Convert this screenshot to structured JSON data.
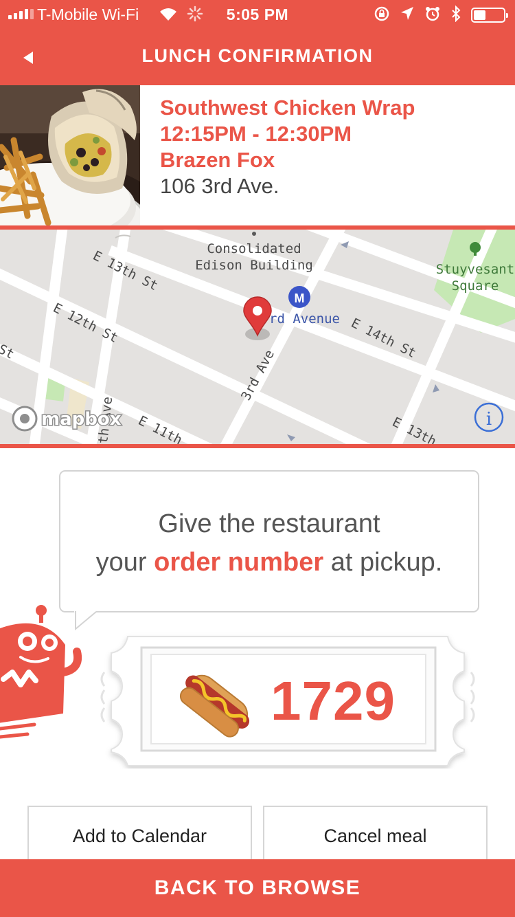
{
  "status_bar": {
    "carrier": "T-Mobile Wi-Fi",
    "time": "5:05 PM",
    "battery_level": 0.42,
    "icons": [
      "signal-icon",
      "wifi-icon",
      "activity-spinner-icon",
      "rotation-lock-icon",
      "location-icon",
      "alarm-icon",
      "bluetooth-icon",
      "battery-icon"
    ]
  },
  "nav": {
    "title": "LUNCH CONFIRMATION",
    "back_icon": "back-arrow-icon"
  },
  "meal": {
    "name": "Southwest Chicken Wrap",
    "time_window": "12:15PM - 12:30PM",
    "restaurant": "Brazen Fox",
    "address": "106 3rd Ave."
  },
  "map": {
    "labels": {
      "landmark": [
        "Consolidated",
        "Edison Building"
      ],
      "park": [
        "Stuyvesant",
        "Square"
      ],
      "station": "rd Avenue",
      "e13": "E 13th St",
      "e12": "E 12th St",
      "e14": "E 14th St",
      "third_ave": "3rd Ave",
      "e11": "E 11th",
      "e13_right": "E 13th",
      "fourth_ave": "th Ave",
      "st_left": "St",
      "attribution": "mapbox"
    },
    "icons": [
      "map-pin-icon",
      "subway-icon",
      "park-tree-icon",
      "mapbox-logo-icon",
      "info-icon"
    ]
  },
  "instructions": {
    "line1": "Give the restaurant",
    "line2_pre": "your ",
    "line2_emphasis": "order number",
    "line2_post": " at pickup."
  },
  "order": {
    "emoji": "🌭",
    "number": "1729"
  },
  "actions": {
    "add_to_calendar": "Add to Calendar",
    "cancel_meal": "Cancel meal",
    "back_to_browse": "BACK TO BROWSE"
  },
  "colors": {
    "brand_red": "#ea5548",
    "map_bg": "#e4e2e0",
    "park_green": "#c6e8b4",
    "link_blue": "#3b6fd6"
  }
}
